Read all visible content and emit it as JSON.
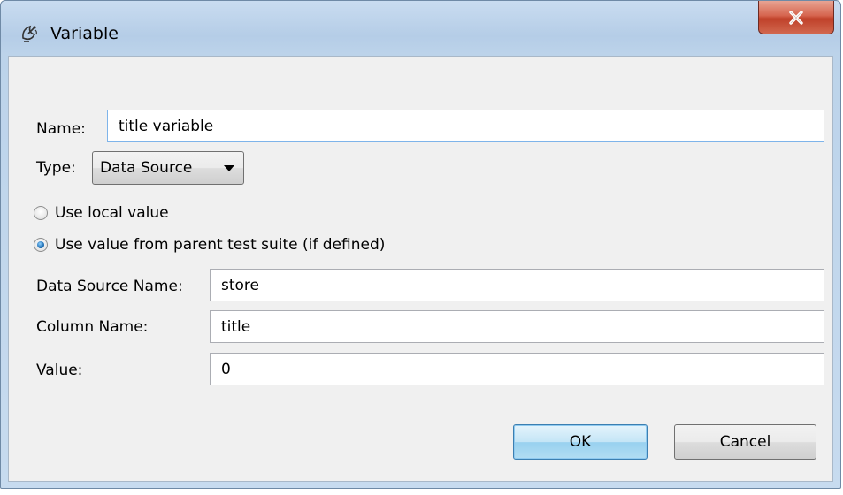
{
  "window": {
    "title": "Variable",
    "close_label": "x"
  },
  "form": {
    "name_label": "Name:",
    "name_value": "title variable",
    "type_label": "Type:",
    "type_selected": "Data Source",
    "radio_local_label": "Use local value",
    "radio_parent_label": "Use value from parent test suite (if defined)",
    "radio_selected": "parent",
    "ds_name_label": "Data Source Name:",
    "ds_name_value": "store",
    "column_label": "Column Name:",
    "column_value": "title",
    "value_label": "Value:",
    "value_value": "0"
  },
  "buttons": {
    "ok_label": "OK",
    "cancel_label": "Cancel"
  },
  "colors": {
    "title_bar": "#bcd3ea",
    "client_bg": "#f0f0f0",
    "close_red": "#c0412a",
    "default_button": "#98d1ef"
  },
  "icons": {
    "app_icon": "satellite-dish-icon",
    "close_icon": "close-icon"
  }
}
